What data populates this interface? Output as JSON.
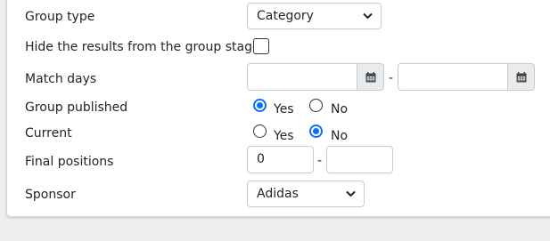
{
  "form": {
    "group_type": {
      "label": "Group type",
      "value": "Category"
    },
    "hide_results": {
      "label": "Hide the results from the group stage",
      "checked": false
    },
    "match_days": {
      "label": "Match days",
      "from": "",
      "to": "",
      "separator": "-"
    },
    "group_published": {
      "label": "Group published",
      "options": [
        "Yes",
        "No"
      ],
      "selected": "Yes"
    },
    "current": {
      "label": "Current",
      "options": [
        "Yes",
        "No"
      ],
      "selected": "No"
    },
    "final_positions": {
      "label": "Final positions",
      "from": "0",
      "to": "",
      "separator": "-"
    },
    "sponsor": {
      "label": "Sponsor",
      "value": "Adidas"
    }
  },
  "icons": {
    "calendar": "calendar-icon",
    "dropdown": "chevron-down-icon"
  },
  "colors": {
    "accent": "#0d6efd",
    "addon_bg": "#e9ecef"
  }
}
